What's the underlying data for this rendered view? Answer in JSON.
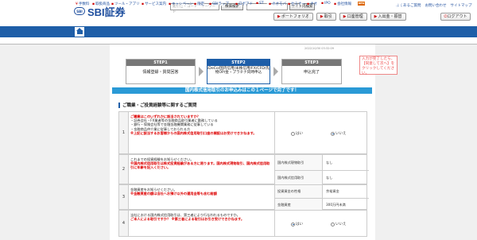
{
  "header": {
    "logo_mark": "SBI",
    "logo_text": "SBI証券",
    "search_placeholder": "銘柄名・コード・キーワード",
    "search_button": "株価検索",
    "site_search_placeholder": "",
    "site_search_button": "サイト内検索",
    "links": [
      "よくあるご質問",
      "お問い合わせ",
      "サイトマップ"
    ],
    "buttons": [
      "ポートフォリオ",
      "取引",
      "口座管理",
      "入出金・振替"
    ],
    "logout": "ログアウト"
  },
  "nav": {
    "items": [
      {
        "main": "マーケット",
        "sub": ""
      },
      {
        "main": "国内株式",
        "sub": ""
      },
      {
        "main": "外国株式",
        "sub": "海外ETF"
      },
      {
        "main": "投信",
        "sub": ""
      },
      {
        "main": "債券",
        "sub": ""
      },
      {
        "main": "FX",
        "sub": ""
      },
      {
        "main": "先物",
        "sub": "オプション"
      },
      {
        "main": "CFD",
        "sub": "eワラント"
      },
      {
        "main": "金・銀",
        "sub": "プラチナ"
      },
      {
        "main": "NISA",
        "sub": "つみたてNISA"
      },
      {
        "main": "iDeCo",
        "sub": "確定拠出年金"
      },
      {
        "main": "銀行",
        "sub": ""
      },
      {
        "main": "保険",
        "sub": ""
      }
    ],
    "ideco_badge": "NEW"
  },
  "subnav": {
    "items": [
      "手数料",
      "取扱商品",
      "ツール・アプリ",
      "サービス案内",
      "キャンペーン",
      "限定",
      "SBIラップ",
      "ロボアド",
      "ST",
      "ネオモバ",
      "セミナー",
      "ネオ",
      "IPO",
      "会社情報"
    ]
  },
  "timestamp": "2022/10/30 03:32:09",
  "steps": [
    {
      "label": "STEP1",
      "body": "情報登録・質問回答"
    },
    {
      "label": "STEP2",
      "body": "iDeCo/国内信用/米株信用/FX/CFD/先物OP/金・プラチナ同時申込"
    },
    {
      "label": "STEP3",
      "body": "申込完了"
    }
  ],
  "side_note": "入力が完了したら、【同意して次へ】をクリックしてください。",
  "banner": "国内株式信用取引のお申込みはこの１ページで完了です！",
  "section_title": "ご職業・ご投資経験等に関するご質問",
  "questions": [
    {
      "num": "1",
      "text_lines": [
        "ご職業はこのいずれかに該当されていますか？",
        "・証券会社・FX業者等の金融商品取引業者に勤務している",
        "・銀行・保険会社等で金融金融機関業務に従事している",
        "・金融商品仲介業に従事しておられる方"
      ],
      "red_line": "※上記に該当するお客様からの国内株式信用取引口座の開設はお受けできかねます。",
      "options": [
        "はい",
        "いいえ"
      ],
      "selected": 1
    },
    {
      "num": "2",
      "text_lines": [
        "これまでの投資経験をお知らせください。"
      ],
      "red_line": "※国内株式信用取引は株式投資経験がある方に限ります。国内株式現物取引、国内株式信用取引に年齢を記入ください。",
      "subrows": [
        {
          "label": "国内株式現物取引",
          "value": "なし"
        },
        {
          "label": "国内株式信用取引",
          "value": "なし"
        }
      ]
    },
    {
      "num": "3",
      "text_lines": [
        "金融資産をお知らせください。"
      ],
      "red_line": "※金融資産の額は当社へお預け以外の運用金等も含む総額",
      "subrows": [
        {
          "label": "投資資金の性格",
          "value": "余裕資金"
        },
        {
          "label": "金融資産",
          "value": "300万円未満"
        }
      ]
    },
    {
      "num": "4",
      "text_lines": [
        "当社における国内株式信用取引は、第三者により行なわれるものですか。"
      ],
      "red_line": "ご本人による取引ですか？ ※第三者による取引はお引き受けできかねます。",
      "options": [
        "はい",
        "いいえ"
      ],
      "selected": 0
    }
  ]
}
